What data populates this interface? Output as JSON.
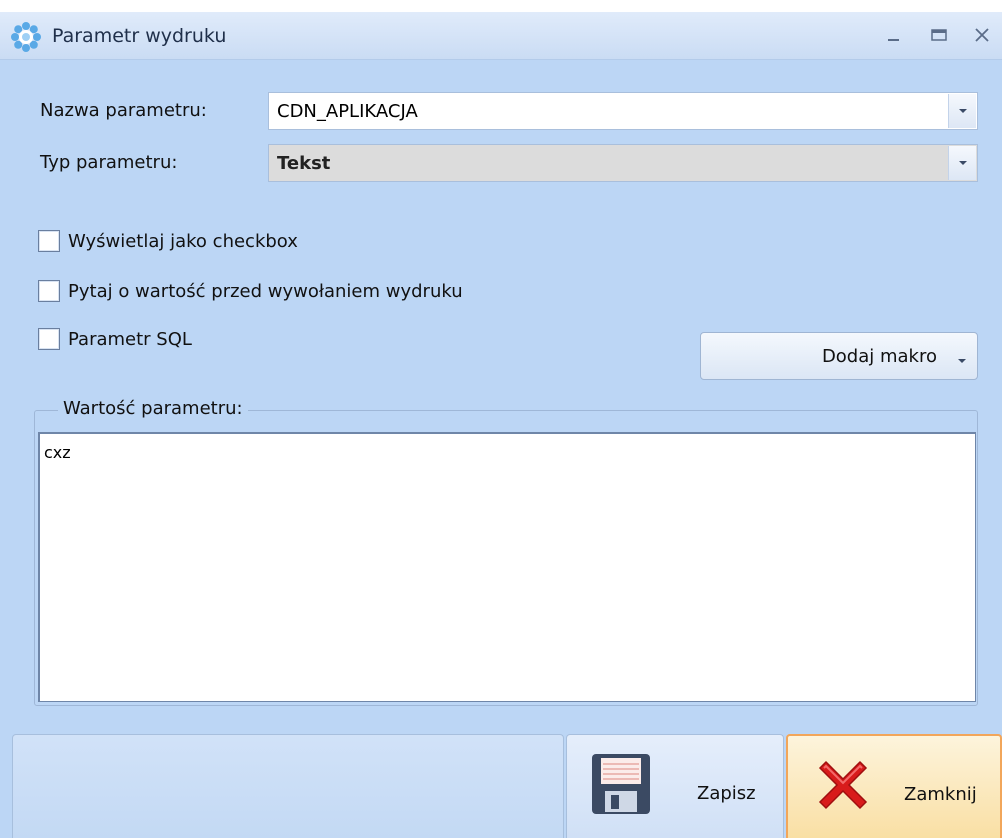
{
  "window": {
    "title": "Parametr wydruku",
    "app_icon": "gear-flower-icon",
    "controls": {
      "minimize": "minimize-icon",
      "maximize": "maximize-icon",
      "close": "close-icon"
    }
  },
  "form": {
    "param_name": {
      "label": "Nazwa parametru:",
      "value": "CDN_APLIKACJA"
    },
    "param_type": {
      "label": "Typ parametru:",
      "value": "Tekst"
    }
  },
  "options": {
    "show_as_checkbox": {
      "label": "Wyświetlaj jako checkbox",
      "checked": false
    },
    "ask_before_print": {
      "label": "Pytaj o wartość przed wywołaniem wydruku",
      "checked": false
    },
    "sql_param": {
      "label": "Parametr SQL",
      "checked": false
    }
  },
  "macro_button": {
    "label": "Dodaj makro"
  },
  "value_group": {
    "legend": "Wartość parametru:",
    "text": "cxz"
  },
  "footer": {
    "save": {
      "label": "Zapisz",
      "icon": "floppy-disk-icon"
    },
    "close": {
      "label": "Zamknij",
      "icon": "red-x-icon"
    }
  },
  "colors": {
    "window_bg": "#bcd6f5",
    "highlight_border": "#f2a65a",
    "close_icon": "#d81b1b"
  }
}
